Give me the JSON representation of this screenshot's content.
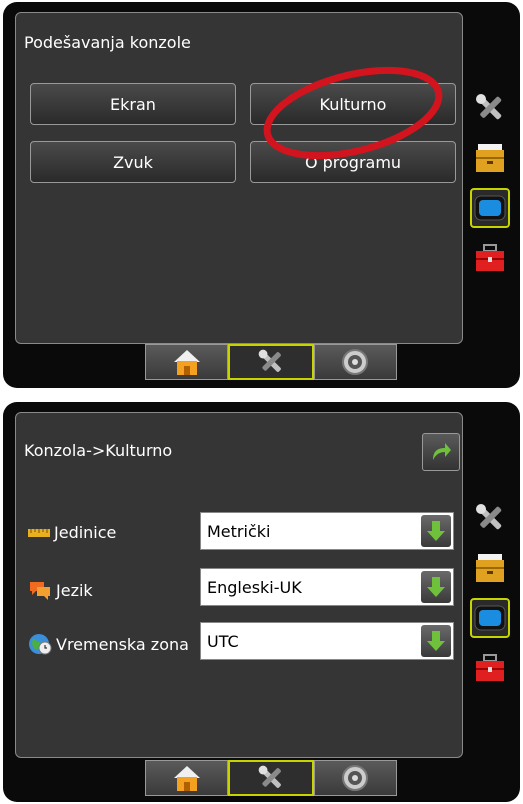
{
  "screen1": {
    "title": "Podešavanja konzole",
    "buttons": [
      "Ekran",
      "Kulturno",
      "Zvuk",
      "O programu"
    ]
  },
  "screen2": {
    "title": "Konzola->Kulturno",
    "rows": [
      {
        "label": "Jedinice",
        "value": "Metrički"
      },
      {
        "label": "Jezik",
        "value": "Engleski-UK"
      },
      {
        "label": "Vremenska zona",
        "value": "UTC"
      }
    ]
  },
  "icons": {
    "side": [
      "tools-icon",
      "drawer-icon",
      "monitor-icon",
      "toolbox-icon"
    ],
    "tabs": [
      "home-icon",
      "tools-icon",
      "gauge-icon"
    ],
    "return": "return-arrow-icon"
  },
  "colors": {
    "selected_border": "#c8d400",
    "highlight_ellipse": "#d2141e",
    "arrow_green": "#6fc03a"
  }
}
